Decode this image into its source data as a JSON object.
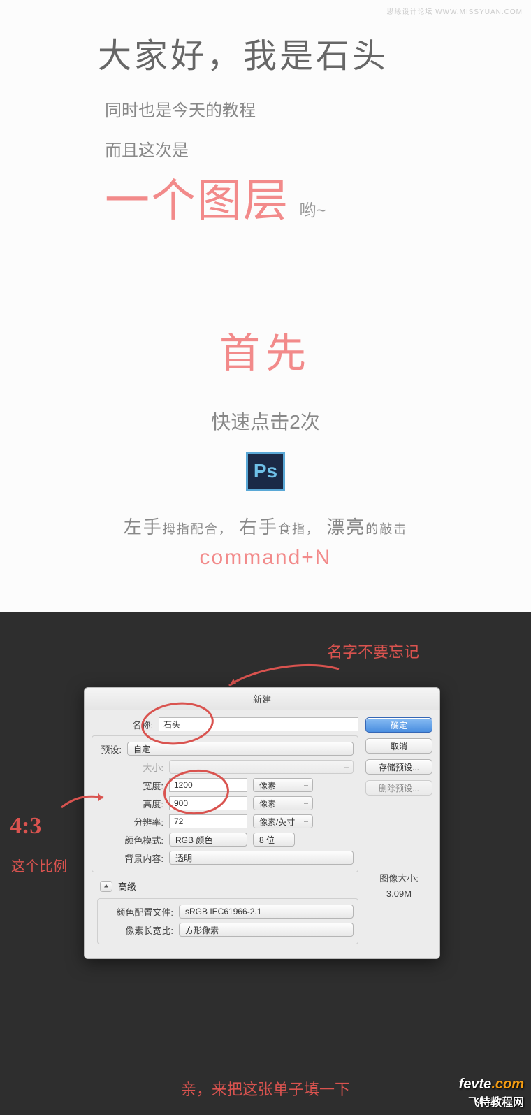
{
  "watermark_top": "思缘设计论坛 WWW.MISSYUAN.COM",
  "intro": {
    "title": "大家好，我是石头",
    "line1": "同时也是今天的教程",
    "line2": "而且这次是",
    "one_layer": "一个图层",
    "yo": "哟~"
  },
  "step": {
    "first": "首先",
    "click_twice": "快速点击2次",
    "ps_label": "Ps",
    "hand_pre1_big": "左手",
    "hand_pre1_small": "拇指配合，",
    "hand_pre2_big": "右手",
    "hand_pre2_small": "食指，",
    "hand_pre3_big": "漂亮",
    "hand_pre3_small": "的敲击",
    "cmd": "command+N"
  },
  "annotations": {
    "name_note": "名字不要忘记",
    "ratio": "4:3",
    "ratio_sub": "这个比例",
    "bottom": "亲，来把这张单子填一下"
  },
  "dialog": {
    "title": "新建",
    "buttons": {
      "ok": "确定",
      "cancel": "取消",
      "save_preset": "存储预设...",
      "delete_preset": "删除预设..."
    },
    "labels": {
      "name": "名称:",
      "preset": "预设:",
      "size": "大小:",
      "width": "宽度:",
      "height": "高度:",
      "resolution": "分辨率:",
      "color_mode": "颜色模式:",
      "bg": "背景内容:",
      "advanced": "高级",
      "profile": "颜色配置文件:",
      "pixel_ratio": "像素长宽比:",
      "image_size_label": "图像大小:"
    },
    "values": {
      "name": "石头",
      "preset": "自定",
      "size": "",
      "width": "1200",
      "height": "900",
      "resolution": "72",
      "width_unit": "像素",
      "height_unit": "像素",
      "resolution_unit": "像素/英寸",
      "color_mode": "RGB 颜色",
      "bit_depth": "8 位",
      "bg": "透明",
      "profile": "sRGB IEC61966-2.1",
      "pixel_ratio": "方形像素",
      "image_size": "3.09M"
    }
  },
  "watermark_bottom": {
    "line1a": "fevte",
    "line1b": ".com",
    "line2": "飞特教程网"
  }
}
